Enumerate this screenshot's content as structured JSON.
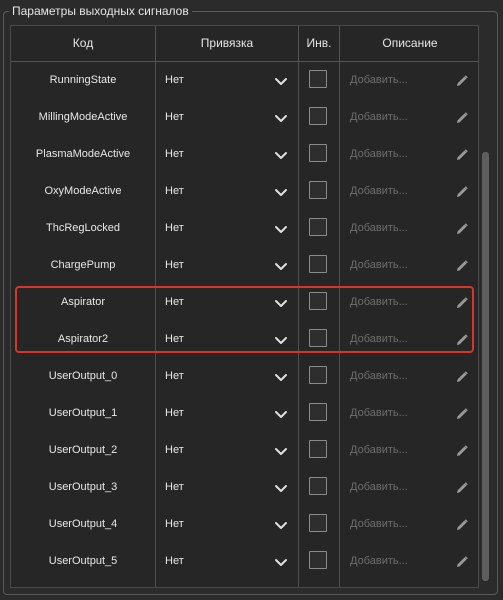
{
  "group": {
    "title": "Параметры выходных сигналов"
  },
  "columns": {
    "code": "Код",
    "binding": "Привязка",
    "inverted": "Инв.",
    "description": "Описание"
  },
  "rows": [
    {
      "code": "RunningState",
      "binding": "Нет",
      "inverted": false,
      "description_placeholder": "Добавить..."
    },
    {
      "code": "MillingModeActive",
      "binding": "Нет",
      "inverted": false,
      "description_placeholder": "Добавить..."
    },
    {
      "code": "PlasmaModeActive",
      "binding": "Нет",
      "inverted": false,
      "description_placeholder": "Добавить..."
    },
    {
      "code": "OxyModeActive",
      "binding": "Нет",
      "inverted": false,
      "description_placeholder": "Добавить..."
    },
    {
      "code": "ThcRegLocked",
      "binding": "Нет",
      "inverted": false,
      "description_placeholder": "Добавить..."
    },
    {
      "code": "ChargePump",
      "binding": "Нет",
      "inverted": false,
      "description_placeholder": "Добавить..."
    },
    {
      "code": "Aspirator",
      "binding": "Нет",
      "inverted": false,
      "description_placeholder": "Добавить...",
      "highlighted": true
    },
    {
      "code": "Aspirator2",
      "binding": "Нет",
      "inverted": false,
      "description_placeholder": "Добавить...",
      "highlighted": true
    },
    {
      "code": "UserOutput_0",
      "binding": "Нет",
      "inverted": false,
      "description_placeholder": "Добавить..."
    },
    {
      "code": "UserOutput_1",
      "binding": "Нет",
      "inverted": false,
      "description_placeholder": "Добавить..."
    },
    {
      "code": "UserOutput_2",
      "binding": "Нет",
      "inverted": false,
      "description_placeholder": "Добавить..."
    },
    {
      "code": "UserOutput_3",
      "binding": "Нет",
      "inverted": false,
      "description_placeholder": "Добавить..."
    },
    {
      "code": "UserOutput_4",
      "binding": "Нет",
      "inverted": false,
      "description_placeholder": "Добавить..."
    },
    {
      "code": "UserOutput_5",
      "binding": "Нет",
      "inverted": false,
      "description_placeholder": "Добавить..."
    }
  ],
  "icons": {
    "dropdown": "chevron-down-icon",
    "edit": "pencil-icon"
  },
  "colors": {
    "highlight": "#d9342b",
    "background": "#2b2b2b",
    "placeholder": "#6e6e6e"
  }
}
